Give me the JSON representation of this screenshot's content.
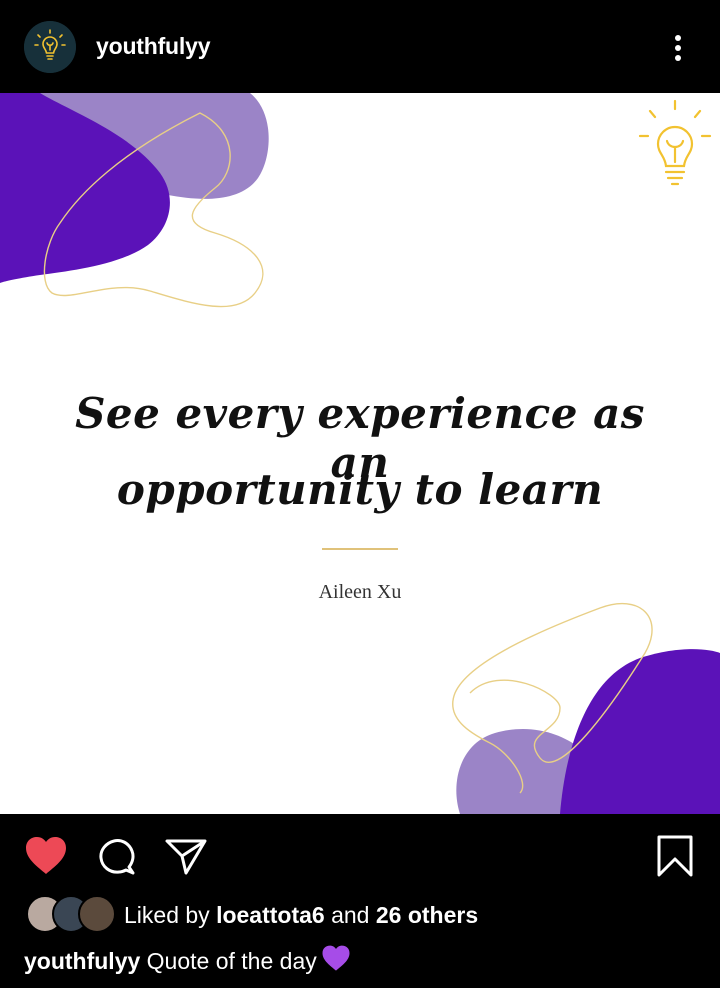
{
  "header": {
    "username": "youthfulyy",
    "avatar_icon": "lightbulb-logo-icon",
    "more_icon": "more-vertical-icon"
  },
  "post": {
    "quote_line1": "See every experience as an",
    "quote_line2": "opportunity to learn",
    "author": "Aileen Xu",
    "colors": {
      "purple_dark": "#5b12b8",
      "purple_light": "#9b84c7",
      "gold": "#f2c230",
      "line_gold": "#e8cf86"
    }
  },
  "actions": {
    "like_icon": "heart-filled-icon",
    "comment_icon": "comment-icon",
    "share_icon": "share-paper-plane-icon",
    "save_icon": "bookmark-icon",
    "like_color": "#ed4956"
  },
  "likes": {
    "prefix": "Liked by ",
    "user": "loeattota6",
    "middle": " and ",
    "others": "26 others"
  },
  "caption": {
    "username": "youthfulyy",
    "text": " Quote of the day",
    "emoji_icon": "purple-heart-icon"
  }
}
